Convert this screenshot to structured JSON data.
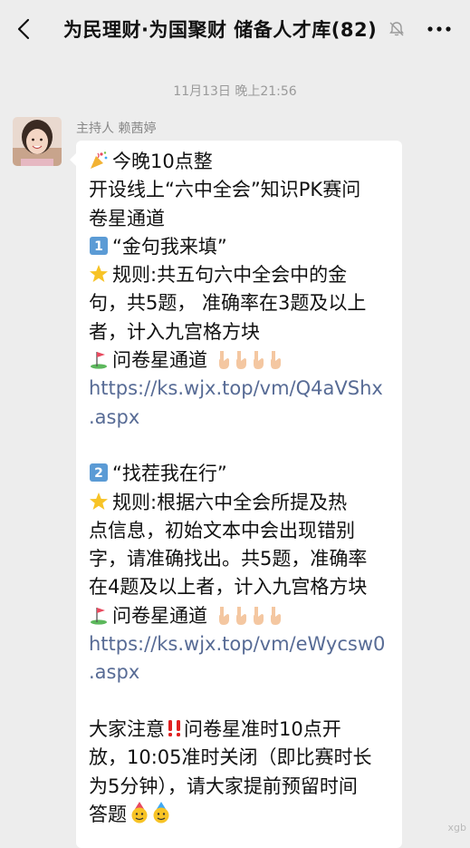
{
  "header": {
    "title": "为民理财·为国聚财 储备人才库(82)",
    "back_icon": "chevron-left-icon",
    "mute_icon": "bell-off-icon",
    "more_icon": "more-dots-icon"
  },
  "chat": {
    "timestamp": "11月13日 晚上21:56",
    "sender_name": "主持人 赖茜婷",
    "message_lines": {
      "l1": "今晚10点整",
      "l2": "开设线上“六中全会”知识PK赛问",
      "l3": "卷星通道",
      "l4": "“金句我来填”",
      "l5": "规则:共五句六中全会中的金",
      "l6": "句，共5题， 准确率在3题及以上",
      "l7": "者，计入九宫格方块",
      "l8": "问卷星通道",
      "l9": "https://ks.wjx.top/vm/Q4aVShx",
      "l10": ".aspx",
      "l11": "“找茬我在行”",
      "l12": "规则:根据六中全会所提及热",
      "l13": "点信息，初始文本中会出现错别",
      "l14": "字，请准确找出。共5题，准确率",
      "l15": "在4题及以上者，计入九宫格方块",
      "l16": "问卷星通道",
      "l17": "https://ks.wjx.top/vm/eWycsw0",
      "l18": ".aspx",
      "l19": "大家注意",
      "l19b": "问卷星准时10点开",
      "l20": "放，10:05准时关闭（即比赛时长",
      "l21": "为5分钟），请大家提前预留时间",
      "l22": "答题"
    }
  },
  "emoji_names": {
    "party": "party-popper-icon",
    "keycap1": "keycap-1-icon",
    "keycap2": "keycap-2-icon",
    "star": "star-icon",
    "golf": "golf-flag-icon",
    "hand": "pointing-down-hand-icon",
    "alert": "double-exclamation-icon",
    "face": "face-with-party-hat-icon"
  },
  "watermark": "xgb",
  "colors": {
    "background": "#ededed",
    "bubble": "#ffffff",
    "link": "#576b95",
    "meta_text": "#9a9a9a"
  }
}
